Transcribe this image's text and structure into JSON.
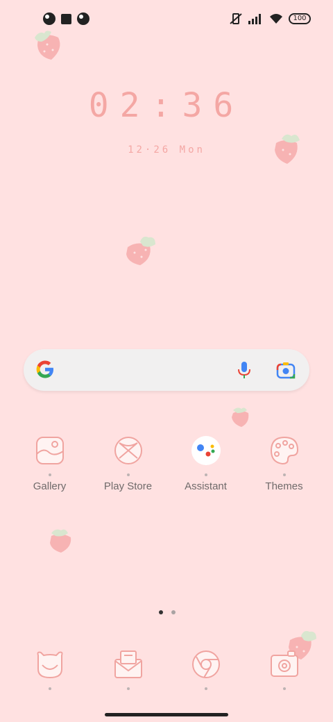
{
  "status_bar": {
    "left_icons": [
      "notification-icon",
      "square-notification-icon",
      "notification-icon"
    ],
    "right_icons": [
      "mute-icon",
      "signal-icon",
      "wifi-icon",
      "battery-icon"
    ],
    "battery": "100"
  },
  "clock_widget": {
    "time": "02:36",
    "date": "12·26 Mon"
  },
  "search_bar": {
    "logo": "google-g-icon",
    "voice_icon": "mic-icon",
    "lens_icon": "lens-icon"
  },
  "apps": [
    {
      "label": "Gallery",
      "icon": "gallery-icon"
    },
    {
      "label": "Play Store",
      "icon": "play-store-icon"
    },
    {
      "label": "Assistant",
      "icon": "assistant-icon"
    },
    {
      "label": "Themes",
      "icon": "themes-icon"
    }
  ],
  "dock": [
    {
      "icon": "phone-icon"
    },
    {
      "icon": "messages-icon"
    },
    {
      "icon": "chrome-icon"
    },
    {
      "icon": "camera-icon"
    }
  ],
  "pager": {
    "pages": 2,
    "current": 1
  },
  "colors": {
    "background": "#ffe1e1",
    "accent": "#f4a7a4",
    "search_bg": "#f1f0f0"
  }
}
